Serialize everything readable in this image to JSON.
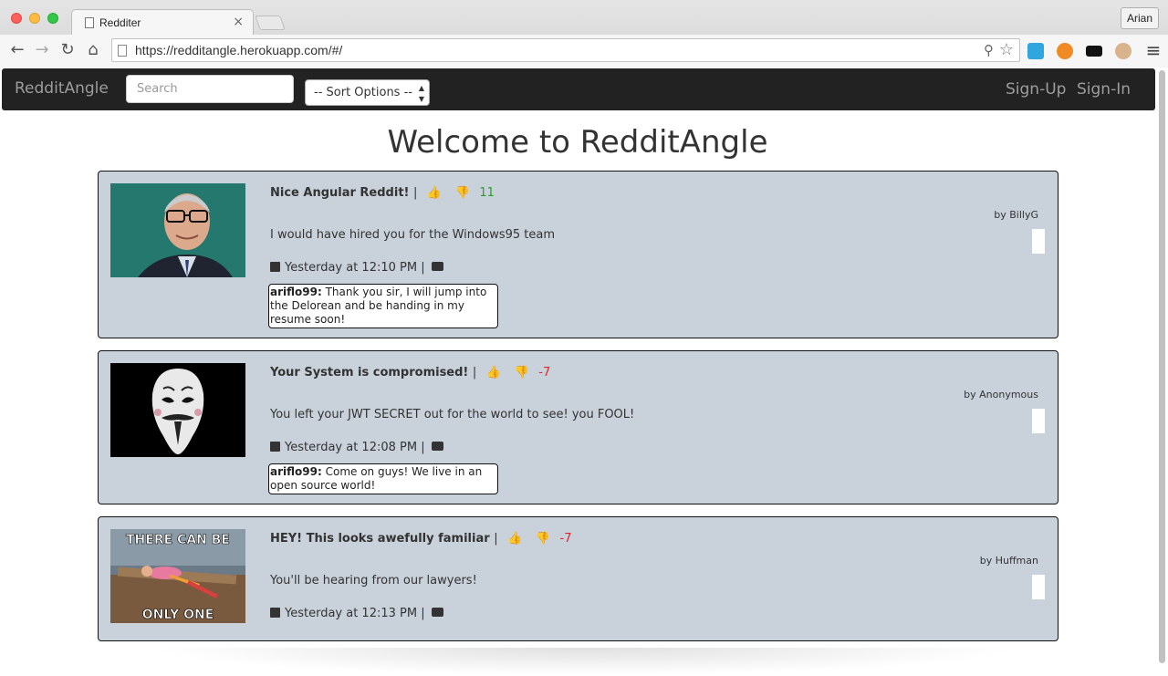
{
  "browser": {
    "tab_title": "Redditer",
    "tab_close": "×",
    "profile": "Arian",
    "url": "https://redditangle.herokuapp.com/#/",
    "back": "←",
    "forward": "→",
    "reload": "↻",
    "home": "⌂",
    "zoom_icon": "⚲",
    "star_icon": "☆",
    "menu_icon": "≡"
  },
  "nav": {
    "brand": "RedditAngle",
    "search_placeholder": "Search",
    "sort_label": "-- Sort Options --",
    "signup": "Sign-Up",
    "signin": "Sign-In"
  },
  "page": {
    "title": "Welcome to RedditAngle"
  },
  "icons": {
    "thumbs_up": "👍",
    "thumbs_down": "👎"
  },
  "posts": [
    {
      "title": "Nice Angular Reddit!",
      "score": "11",
      "score_color": "#2aa02a",
      "author": "by BillyG",
      "body": "I would have hired you for the Windows95 team",
      "time": "Yesterday at 12:10 PM",
      "comment_user": "ariflo99:",
      "comment_text": "Thank you sir, I will jump into the Delorean and be handing in my resume soon!"
    },
    {
      "title": "Your System is compromised!",
      "score": "-7",
      "score_color": "#e2232a",
      "author": "by Anonymous",
      "body": "You left your JWT SECRET out for the world to see! you FOOL!",
      "time": "Yesterday at 12:08 PM",
      "comment_user": "ariflo99:",
      "comment_text": "Come on guys! We live in an open source world!"
    },
    {
      "title": "HEY! This looks awefully familiar",
      "score": "-7",
      "score_color": "#e2232a",
      "author": "by Huffman",
      "body": "You'll be hearing from our lawyers!",
      "time": "Yesterday at 12:13 PM",
      "thumb_text_top": "THERE CAN BE",
      "thumb_text_bottom": "ONLY ONE"
    }
  ]
}
